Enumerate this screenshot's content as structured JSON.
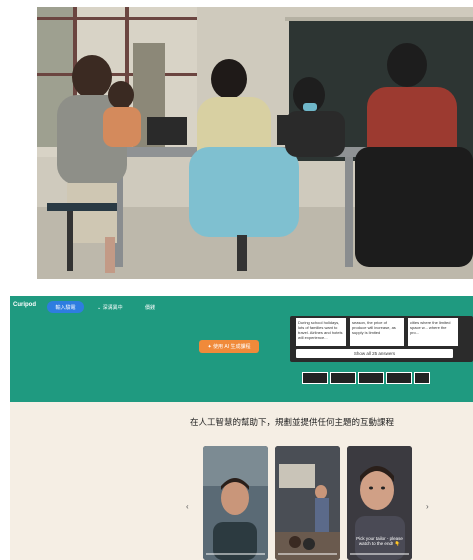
{
  "nav": {
    "logo": "Curipod",
    "pill_label": "輸入驗電",
    "link_1": "⌄ 深溝異中",
    "link_2": "價錢"
  },
  "hero": {
    "cta_label": "✦ 使用 AI 生成課程",
    "cards": [
      "During school holidays, lots of families want to travel. Airlines and hotels will experience...",
      "season, the price of produce will increase, as supply is limited",
      "cities where the limited space w... where the pro..."
    ],
    "show_all_label": "Show all 25 answers"
  },
  "main": {
    "heading": "在人工智慧的幫助下，規劃並提供任何主題的互動課程",
    "arrow_left": "‹",
    "arrow_right": "›",
    "video_caption": "Pick your tailor - please watch to the end! 👇"
  },
  "colors": {
    "brand_green": "#1f9a80",
    "cta_orange": "#f08a3a",
    "pill_blue": "#2e7de0",
    "cream": "#f5eee4"
  }
}
